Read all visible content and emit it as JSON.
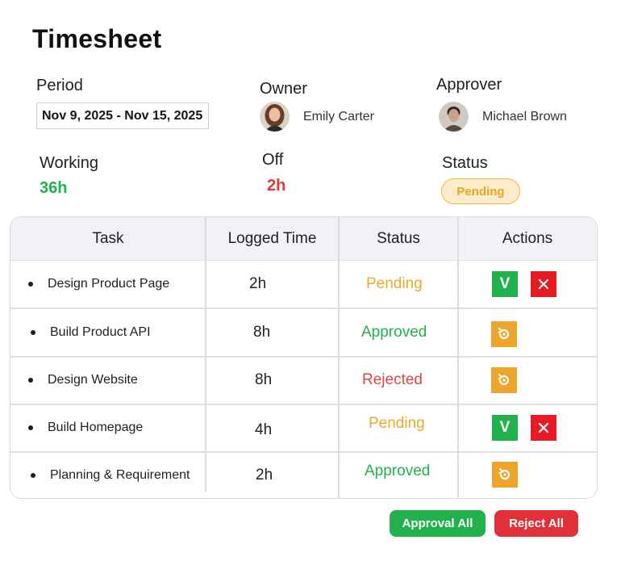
{
  "title": "Timesheet",
  "period": {
    "label": "Period",
    "value": "Nov 9, 2025 - Nov 15, 2025"
  },
  "owner": {
    "label": "Owner",
    "name": "Emily Carter"
  },
  "approver": {
    "label": "Approver",
    "name": "Michael Brown"
  },
  "working": {
    "label": "Working",
    "value": "36h"
  },
  "off": {
    "label": "Off",
    "value": "2h"
  },
  "status": {
    "label": "Status",
    "value": "Pending"
  },
  "table": {
    "headers": [
      "Task",
      "Logged Time",
      "Status",
      "Actions"
    ],
    "rows": [
      {
        "task": "Design Product Page",
        "logged": "2h",
        "status": "Pending",
        "approve_label": "V"
      },
      {
        "task": "Build Product API",
        "logged": "8h",
        "status": "Approved"
      },
      {
        "task": "Design Website",
        "logged": "8h",
        "status": "Rejected"
      },
      {
        "task": "Build Homepage",
        "logged": "4h",
        "status": "Pending",
        "approve_label": "V"
      },
      {
        "task": "Planning & Requirement",
        "logged": "2h",
        "status": "Approved"
      }
    ]
  },
  "footer": {
    "approve_all": "Approval All",
    "reject_all": "Reject All"
  },
  "colors": {
    "green": "#22b14c",
    "red": "#e61c24",
    "orange": "#eda52c",
    "pending_text": "#eda82a"
  },
  "icons": {
    "approve": "check-v",
    "reject": "close-icon",
    "reopen": "redo-icon"
  }
}
